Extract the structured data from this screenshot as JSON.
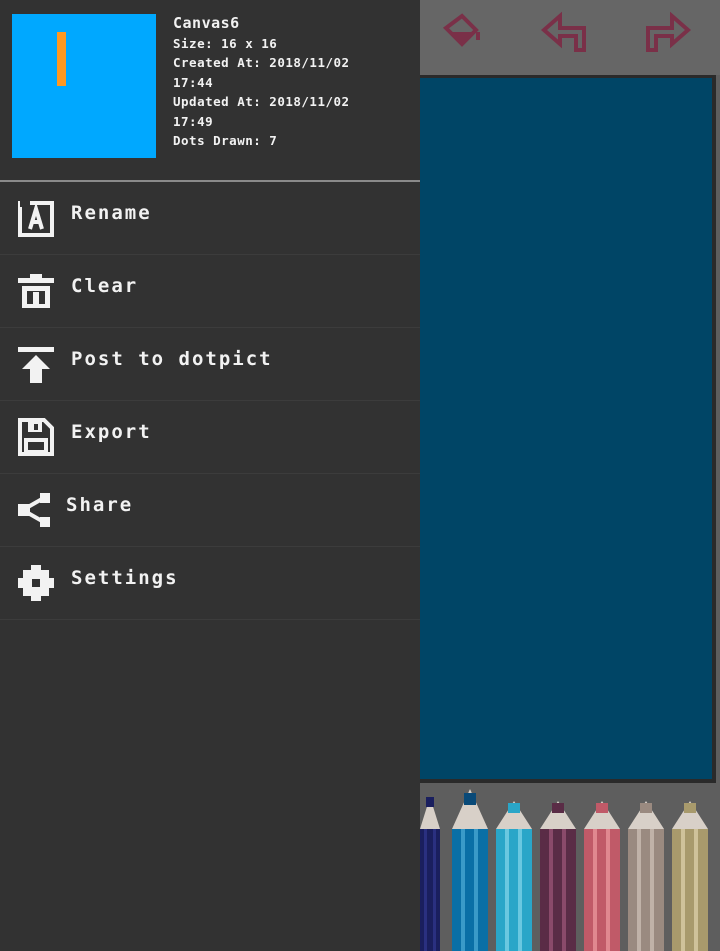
{
  "canvas_info": {
    "title": "Canvas6",
    "size": "Size: 16 x 16",
    "created_line1": "Created At: 2018/11/02",
    "created_line2": "17:44",
    "updated_line1": "Updated At: 2018/11/02",
    "updated_line2": "17:49",
    "dots_drawn": "Dots Drawn: 7",
    "thumbnail_bg_color": "#00a8ff",
    "thumbnail_pixel_color": "#ff9821"
  },
  "menu": [
    {
      "label": "Rename",
      "icon": "rename-icon"
    },
    {
      "label": "Clear",
      "icon": "trash-icon"
    },
    {
      "label": "Post to dotpict",
      "icon": "upload-icon"
    },
    {
      "label": "Export",
      "icon": "save-icon"
    },
    {
      "label": "Share",
      "icon": "share-icon"
    },
    {
      "label": "Settings",
      "icon": "gear-icon"
    }
  ],
  "toolbar_icons": [
    "fill-bucket-icon",
    "undo-icon",
    "redo-icon"
  ],
  "canvas_color": "#004566",
  "pencil_colors": [
    "#1a1f5e",
    "#0a6fa6",
    "#2aa6c8",
    "#5a2c46",
    "#c05a68",
    "#9a8a80",
    "#a89a6c"
  ]
}
